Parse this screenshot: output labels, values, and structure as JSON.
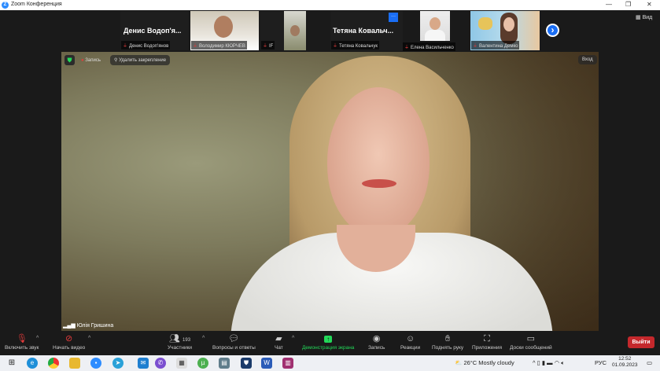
{
  "window": {
    "title": "Zoom Конференция",
    "minimize": "—",
    "maximize": "❐",
    "close": "✕"
  },
  "view_button": "Вид",
  "participants_strip": [
    {
      "display_name": "Денис Водоп'я...",
      "label": "Денис Водоп'янов"
    },
    {
      "label": "Володимир КЮРЧЕВ"
    },
    {
      "label": "IF"
    },
    {
      "display_name": "Тетяна  Ковальч...",
      "label": "Тетяна Ковальчук",
      "menu": "···"
    },
    {
      "label": "Елена Васильченко"
    },
    {
      "label": "Валентина Демко"
    }
  ],
  "next_arrow": "›",
  "main_video": {
    "record_label": "Запись",
    "unpin_label": "Удалить закрепление",
    "enter_label": "Вход",
    "speaker_name": "Юлія Гришина"
  },
  "toolbar": {
    "unmute": "Включить звук",
    "start_video": "Начать видео",
    "participants": "Участники",
    "participants_count": "193",
    "qa": "Вопросы и ответы",
    "chat": "Чат",
    "share": "Демонстрация экрана",
    "record": "Запись",
    "reactions": "Реакции",
    "raise_hand": "Поднять руку",
    "apps": "Приложения",
    "whiteboards": "Доски сообщений",
    "leave": "Выйти"
  },
  "taskbar": {
    "weather": "26°C  Mostly cloudy",
    "lang": "РУС",
    "time": "12:52",
    "date": "01.09.2023"
  },
  "colors": {
    "accent": "#2d8cff",
    "leave": "#c4282c",
    "share": "#23d959"
  }
}
